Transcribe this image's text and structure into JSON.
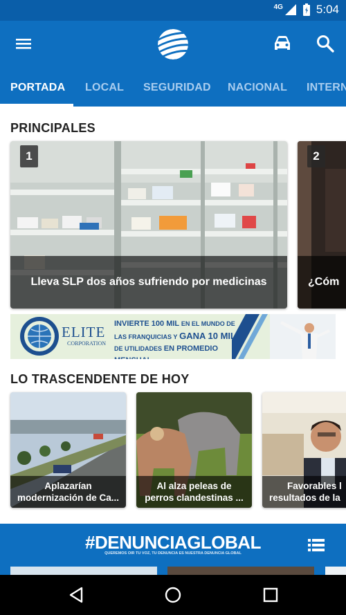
{
  "status_bar": {
    "network": "4G",
    "time": "5:04"
  },
  "tabs": [
    "PORTADA",
    "LOCAL",
    "SEGURIDAD",
    "NACIONAL",
    "INTERN"
  ],
  "principales": {
    "title": "PRINCIPALES",
    "items": [
      {
        "rank": "1",
        "headline": "Lleva SLP dos años sufriendo por medicinas"
      },
      {
        "rank": "2",
        "headline": "¿Cóm"
      }
    ]
  },
  "ad_banner": {
    "brand": "ELITE",
    "brand_sub": "CORPORATION",
    "line1a": "INVIERTE 100 MIL",
    "line1b": "EN EL MUNDO DE",
    "line2a": "LAS FRANQUICIAS Y",
    "line2b": "GANA 10 MIL",
    "line3a": "DE UTILIDADES",
    "line3b": "EN PROMEDIO MENSUAL"
  },
  "trascendente": {
    "title": "LO TRASCENDENTE DE HOY",
    "items": [
      {
        "line1": "Aplazarían",
        "line2": "modernización de Ca..."
      },
      {
        "line1": "Al alza peleas de",
        "line2": "perros clandestinas ..."
      },
      {
        "line1": "Favorables l",
        "line2": "resultados de la"
      }
    ]
  },
  "denuncia": {
    "title": "#DENUNCIAGLOBAL",
    "slogan": "QUEREMOS OIR TU VOZ, TU DENUNCIA ES NUESTRA DENUNCIA GLOBAL"
  },
  "colors": {
    "primary": "#0e6fc0",
    "status": "#0a5ea9"
  },
  "icons": [
    "menu-icon",
    "logo-globe",
    "car-icon",
    "search-icon",
    "list-icon",
    "back-icon",
    "home-icon",
    "recents-icon"
  ]
}
